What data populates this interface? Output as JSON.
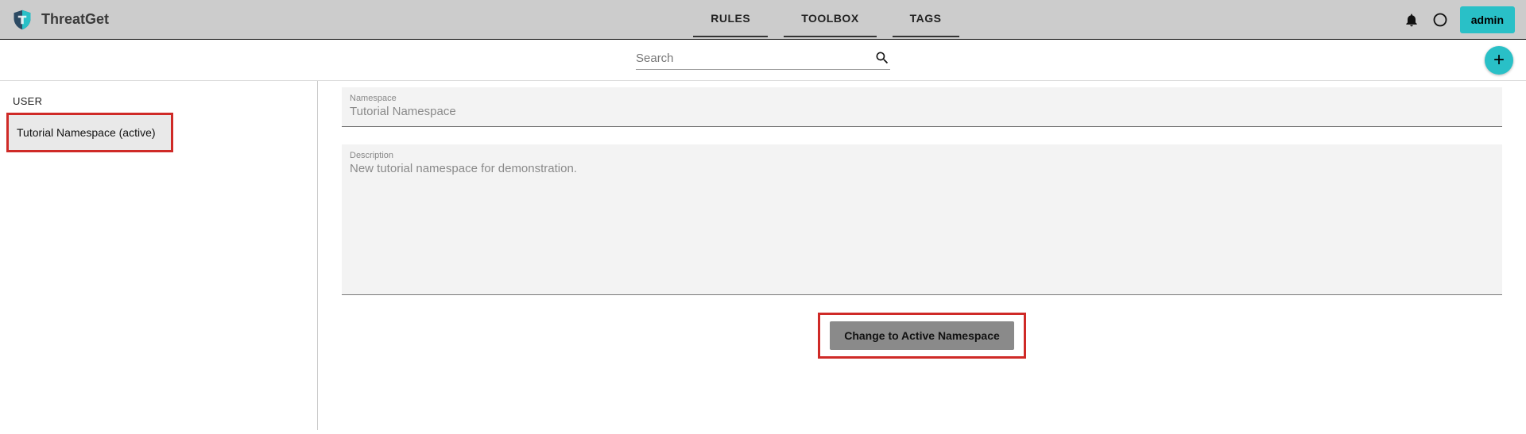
{
  "header": {
    "brand": "ThreatGet",
    "nav": {
      "rules": "RULES",
      "toolbox": "TOOLBOX",
      "tags": "TAGS"
    },
    "user_button": "admin"
  },
  "subbar": {
    "search_placeholder": "Search"
  },
  "sidebar": {
    "section_label": "USER",
    "items": [
      {
        "label": "Tutorial Namespace (active)"
      }
    ]
  },
  "content": {
    "namespace": {
      "label": "Namespace",
      "value": "Tutorial Namespace"
    },
    "description": {
      "label": "Description",
      "value": "New tutorial namespace for demonstration."
    },
    "action_button": "Change to Active Namespace"
  },
  "colors": {
    "accent": "#29c0c7",
    "highlight": "#cf2a27"
  }
}
